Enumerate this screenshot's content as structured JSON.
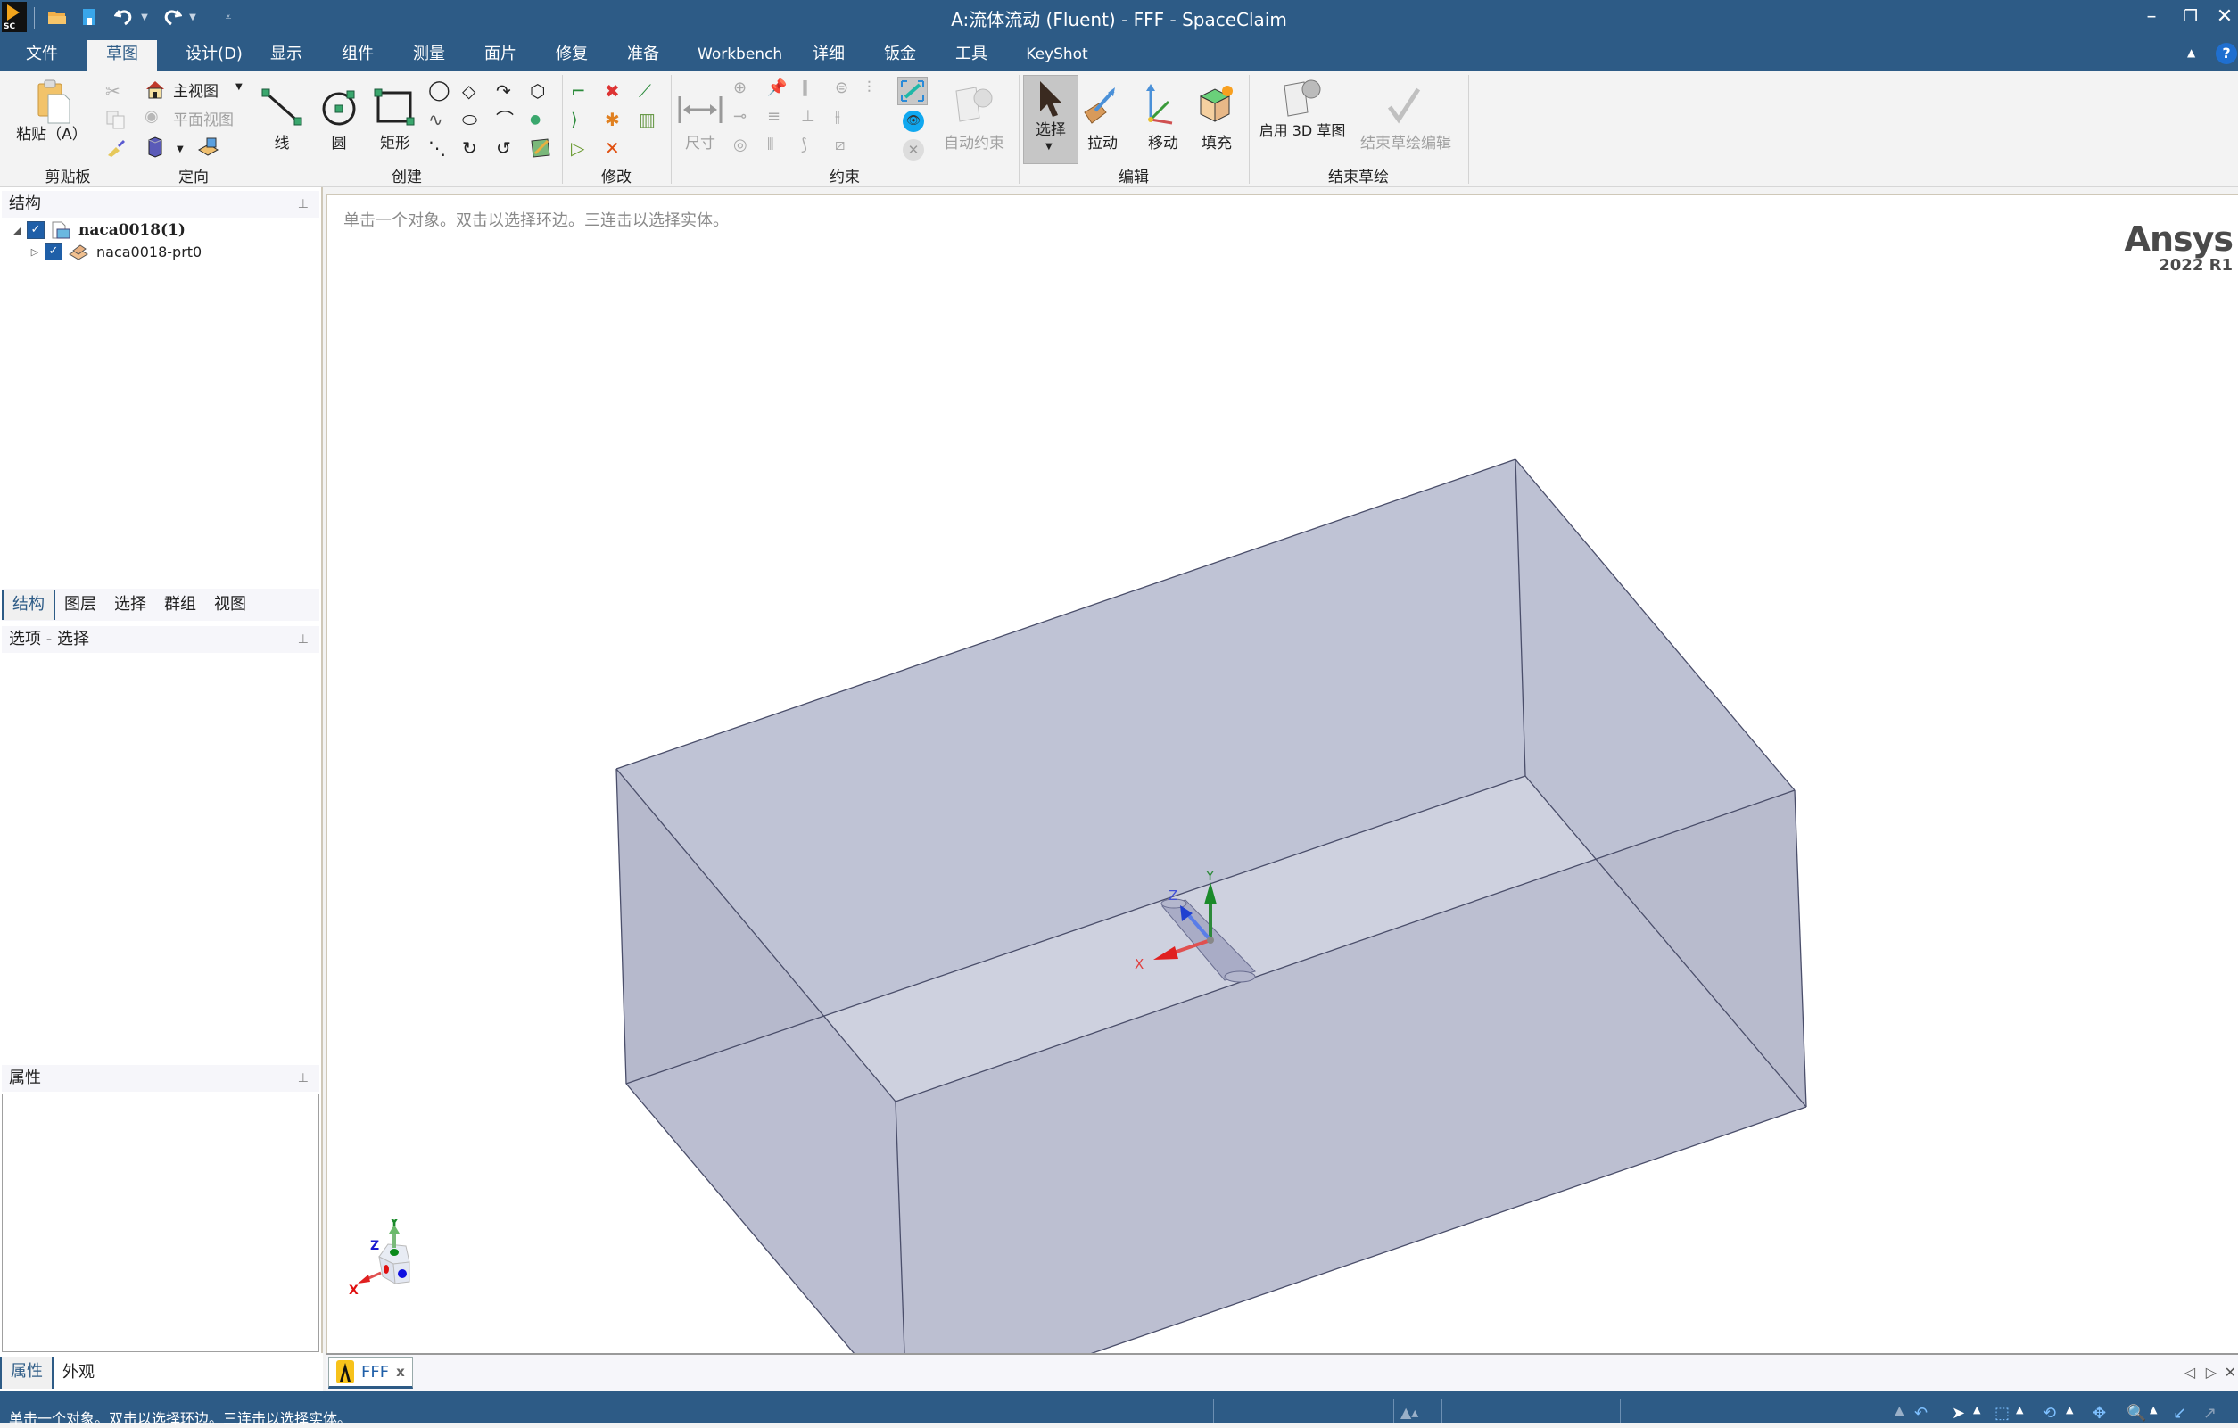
{
  "window": {
    "title": "A:流体流动 (Fluent)  - FFF - SpaceClaim",
    "app_icon": "spaceclaim-logo",
    "quick_access": [
      "open-icon",
      "save-icon",
      "undo-icon",
      "redo-icon",
      "customize-icon"
    ],
    "controls": {
      "minimize": "–",
      "restore": "❐",
      "close": "✕"
    }
  },
  "ribbon_tabs": [
    {
      "label": "文件",
      "active": false
    },
    {
      "label": "草图",
      "active": true
    },
    {
      "label": "设计(D)",
      "active": false
    },
    {
      "label": "显示",
      "active": false
    },
    {
      "label": "组件",
      "active": false
    },
    {
      "label": "测量",
      "active": false
    },
    {
      "label": "面片",
      "active": false
    },
    {
      "label": "修复",
      "active": false
    },
    {
      "label": "准备",
      "active": false
    },
    {
      "label": "Workbench",
      "active": false
    },
    {
      "label": "详细",
      "active": false
    },
    {
      "label": "钣金",
      "active": false
    },
    {
      "label": "工具",
      "active": false
    },
    {
      "label": "KeyShot",
      "active": false
    }
  ],
  "ribbon": {
    "clipboard": {
      "label": "剪贴板",
      "paste": "粘贴（A）"
    },
    "orient": {
      "label": "定向",
      "home_view": "主视图",
      "plan_view": "平面视图"
    },
    "create": {
      "label": "创建",
      "line": "线",
      "circle": "圆",
      "rectangle": "矩形"
    },
    "modify": {
      "label": "修改"
    },
    "constraints": {
      "label": "约束",
      "dimension": "尺寸",
      "auto_constrain": "自动约束"
    },
    "edit": {
      "label": "编辑",
      "select": "选择",
      "pull": "拉动",
      "move": "移动",
      "fill": "填充"
    },
    "end_sketch": {
      "label": "结束草绘",
      "enable_3d": "启用 3D 草图",
      "end_edit": "结束草绘编辑"
    }
  },
  "structure_panel": {
    "title": "结构",
    "tree": [
      {
        "label": "naca0018(1)",
        "checked": true,
        "expanded": true,
        "bold": true,
        "icon": "document-icon"
      },
      {
        "label": "naca0018-prt0",
        "checked": true,
        "expanded": false,
        "bold": false,
        "icon": "part-icon"
      }
    ],
    "tabs": [
      {
        "label": "结构",
        "active": true
      },
      {
        "label": "图层",
        "active": false
      },
      {
        "label": "选择",
        "active": false
      },
      {
        "label": "群组",
        "active": false
      },
      {
        "label": "视图",
        "active": false
      }
    ]
  },
  "options_panel": {
    "title": "选项 - 选择"
  },
  "properties_panel": {
    "title": "属性",
    "tabs": [
      {
        "label": "属性",
        "active": true
      },
      {
        "label": "外观",
        "active": false
      }
    ]
  },
  "viewport": {
    "hint": "单击一个对象。双击以选择环边。三连击以选择实体。",
    "brand": "Ansys",
    "version": "2022 R1",
    "triad_labels": {
      "x": "X",
      "y": "Y",
      "z": "Z"
    },
    "colors": {
      "x": "#e02020",
      "y": "#1a8a2a",
      "z": "#2040d0",
      "box_fill": "#bcc0d4",
      "edge": "#4a4e6a"
    }
  },
  "doc_tabs": [
    {
      "label": "FFF",
      "close": "x"
    }
  ],
  "doc_nav": {
    "prev": "◁",
    "next": "▷",
    "close": "✕"
  },
  "status_bar": {
    "text": "单击一个对象。双击以选择环边。三连击以选择实体。"
  }
}
